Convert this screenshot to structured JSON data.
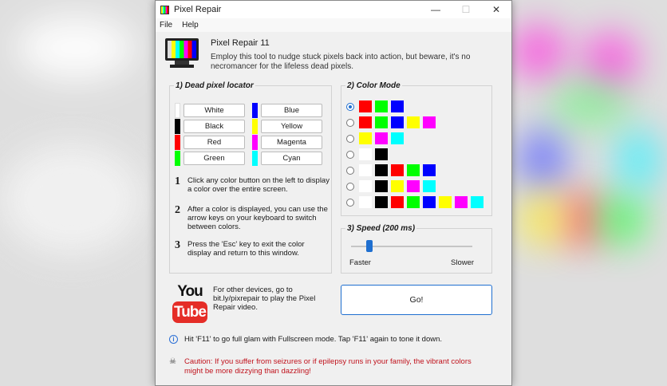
{
  "window": {
    "title": "Pixel Repair",
    "min": "—",
    "max": "☐",
    "close": "✕"
  },
  "menu": {
    "file": "File",
    "help": "Help"
  },
  "header": {
    "app_name": "Pixel Repair 11",
    "description": "Employ this tool to nudge stuck pixels back into action, but beware, it's no necromancer for the lifeless dead pixels."
  },
  "locator": {
    "title": "1) Dead pixel locator",
    "left_buttons": [
      {
        "label": "White",
        "color": "#ffffff"
      },
      {
        "label": "Black",
        "color": "#000000"
      },
      {
        "label": "Red",
        "color": "#ff0000"
      },
      {
        "label": "Green",
        "color": "#00ff00"
      }
    ],
    "right_buttons": [
      {
        "label": "Blue",
        "color": "#0000ff"
      },
      {
        "label": "Yellow",
        "color": "#ffff00"
      },
      {
        "label": "Magenta",
        "color": "#ff00ff"
      },
      {
        "label": "Cyan",
        "color": "#00ffff"
      }
    ],
    "steps": [
      {
        "num": "1",
        "text": "Click any color button on the left to display a color over the entire screen."
      },
      {
        "num": "2",
        "text": "After a color is displayed, you can use the arrow keys on your keyboard to switch between colors."
      },
      {
        "num": "3",
        "text": "Press the 'Esc' key to exit the color display and return to this window."
      }
    ]
  },
  "color_mode": {
    "title": "2) Color Mode",
    "selected": 0,
    "modes": [
      [
        "#ff0000",
        "#00ff00",
        "#0000ff"
      ],
      [
        "#ff0000",
        "#00ff00",
        "#0000ff",
        "#ffff00",
        "#ff00ff"
      ],
      [
        "#ffff00",
        "#ff00ff",
        "#00ffff"
      ],
      [
        "#ffffff",
        "#000000"
      ],
      [
        "#ffffff",
        "#000000",
        "#ff0000",
        "#00ff00",
        "#0000ff"
      ],
      [
        "#ffffff",
        "#000000",
        "#ffff00",
        "#ff00ff",
        "#00ffff"
      ],
      [
        "#ffffff",
        "#000000",
        "#ff0000",
        "#00ff00",
        "#0000ff",
        "#ffff00",
        "#ff00ff",
        "#00ffff"
      ]
    ]
  },
  "speed": {
    "title": "3) Speed (200 ms)",
    "faster": "Faster",
    "slower": "Slower"
  },
  "youtube": {
    "logo_top": "You",
    "logo_bottom": "Tube",
    "text": "For other devices, go to bit.ly/pixrepair to play the Pixel Repair video."
  },
  "go_button": "Go!",
  "info": "Hit 'F11' to go full glam with Fullscreen mode. Tap 'F11' again to tone it down.",
  "caution": "Caution: If you suffer from seizures or if epilepsy runs in your family, the vibrant colors might be more dizzying than dazzling!",
  "colors": {
    "accent": "#1f6fd0",
    "caution": "#c0121c",
    "youtube_red": "#e52d27"
  }
}
